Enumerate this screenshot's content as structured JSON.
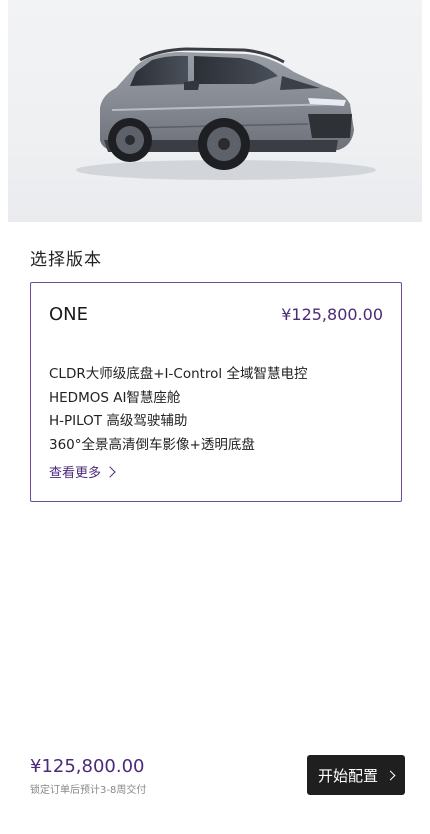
{
  "hero": {
    "image_alt": "car-image"
  },
  "section": {
    "title": "选择版本"
  },
  "version": {
    "name": "ONE",
    "price": "¥125,800.00",
    "features": [
      "CLDR大师级底盘+I-Control 全域智慧电控",
      "HEDMOS AI智慧座舱",
      "H-PILOT 高级驾驶辅助",
      "360°全景高清倒车影像+透明底盘"
    ],
    "more_label": "查看更多"
  },
  "footer": {
    "price": "¥125,800.00",
    "note": "锁定订单后预计3-8周交付",
    "cta_label": "开始配置"
  },
  "colors": {
    "accent": "#4b2a7a",
    "cta_bg": "#1f1f1f"
  }
}
